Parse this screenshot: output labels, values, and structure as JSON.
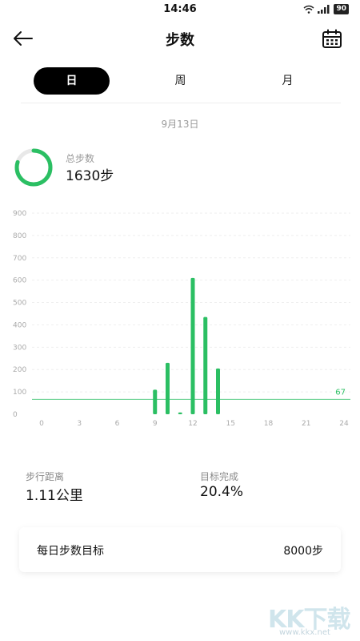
{
  "status_bar": {
    "time": "14:46",
    "battery": "90"
  },
  "header": {
    "title": "步数"
  },
  "tabs": [
    {
      "label": "日",
      "active": true
    },
    {
      "label": "周",
      "active": false
    },
    {
      "label": "月",
      "active": false
    }
  ],
  "date": "9月13日",
  "summary": {
    "total_label": "总步数",
    "total_value": "1630步",
    "ring_progress": 0.8
  },
  "chart_data": {
    "type": "bar",
    "x": [
      9,
      10,
      11,
      12,
      13,
      14
    ],
    "values": [
      110,
      230,
      8,
      610,
      435,
      205
    ],
    "xticks": [
      0,
      3,
      6,
      9,
      12,
      15,
      18,
      21,
      24
    ],
    "yticks": [
      0,
      100,
      200,
      300,
      400,
      500,
      600,
      700,
      800,
      900
    ],
    "xlim": [
      0,
      24
    ],
    "ylim": [
      0,
      900
    ],
    "reference_line": {
      "value": 67,
      "label": "67"
    },
    "grid": true,
    "color": "#2bbf63"
  },
  "stats": {
    "distance_label": "步行距离",
    "distance_value": "1.11公里",
    "goal_label": "目标完成",
    "goal_value": "20.4%"
  },
  "goal_card": {
    "label": "每日步数目标",
    "value": "8000步"
  },
  "watermark": {
    "logo": "KK下载",
    "url": "www.kkx.net"
  },
  "colors": {
    "accent": "#2bbf63",
    "ring_track": "#e8e8e8"
  }
}
